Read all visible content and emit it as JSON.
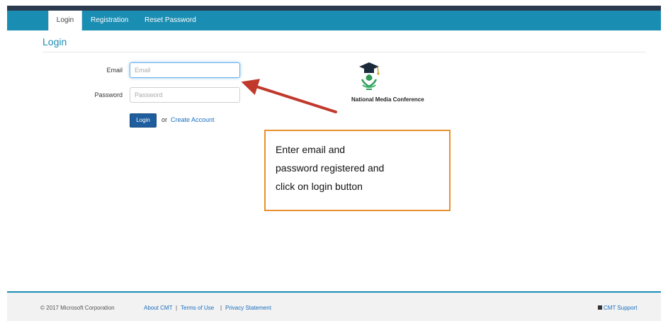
{
  "nav": {
    "tabs": [
      {
        "label": "Login",
        "active": true
      },
      {
        "label": "Registration",
        "active": false
      },
      {
        "label": "Reset Password",
        "active": false
      }
    ]
  },
  "page": {
    "title": "Login"
  },
  "form": {
    "email_label": "Email",
    "email_placeholder": "Email",
    "email_value": "",
    "password_label": "Password",
    "password_placeholder": "Password",
    "password_value": "",
    "login_button": "Login",
    "or_text": "or",
    "create_account_link": "Create Account"
  },
  "logo": {
    "text": "National Media Conference",
    "icon": "graduation-cap-icon"
  },
  "callout": {
    "lines": [
      "Enter email and",
      "password registered and",
      "click on login button"
    ]
  },
  "footer": {
    "copyright": "© 2017 Microsoft Corporation",
    "about_link": "About CMT",
    "terms_link": "Terms of Use",
    "privacy_link": "Privacy Statement",
    "separator": "|",
    "support_link": "CMT Support"
  },
  "colors": {
    "brand": "#1a8db3",
    "top_stripe": "#2b3a4f",
    "button": "#1f5e9e",
    "callout_border": "#e8912e",
    "arrow": "#c0392b"
  }
}
